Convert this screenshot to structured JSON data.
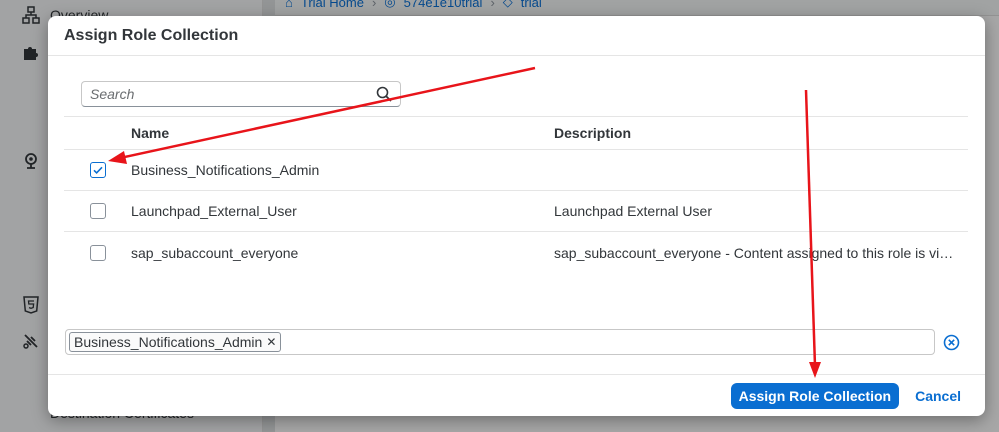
{
  "background": {
    "sidebar": {
      "items": [
        {
          "label": "Overview",
          "icon": "hierarchy-icon"
        },
        {
          "label": "",
          "icon": "puzzle-icon"
        },
        {
          "label": "",
          "icon": "location-icon"
        },
        {
          "label": "",
          "icon": "html5-icon"
        },
        {
          "label": "",
          "icon": "connection-icon"
        }
      ],
      "footer_label": "Destination Certificates"
    },
    "breadcrumbs": [
      "Trial Home",
      "574e1e10trial",
      "trial"
    ]
  },
  "dialog": {
    "title": "Assign Role Collection",
    "search": {
      "placeholder": "Search",
      "value": ""
    },
    "table": {
      "columns": [
        "Name",
        "Description"
      ],
      "rows": [
        {
          "checked": true,
          "name": "Business_Notifications_Admin",
          "description": ""
        },
        {
          "checked": false,
          "name": "Launchpad_External_User",
          "description": "Launchpad External User"
        },
        {
          "checked": false,
          "name": "sap_subaccount_everyone",
          "description": "sap_subaccount_everyone - Content assigned to this role is visi..."
        }
      ]
    },
    "tokens": [
      "Business_Notifications_Admin"
    ],
    "footer": {
      "primary_label": "Assign Role Collection",
      "cancel_label": "Cancel"
    }
  },
  "colors": {
    "accent": "#0a6ed1",
    "annotation": "#e8141a"
  }
}
